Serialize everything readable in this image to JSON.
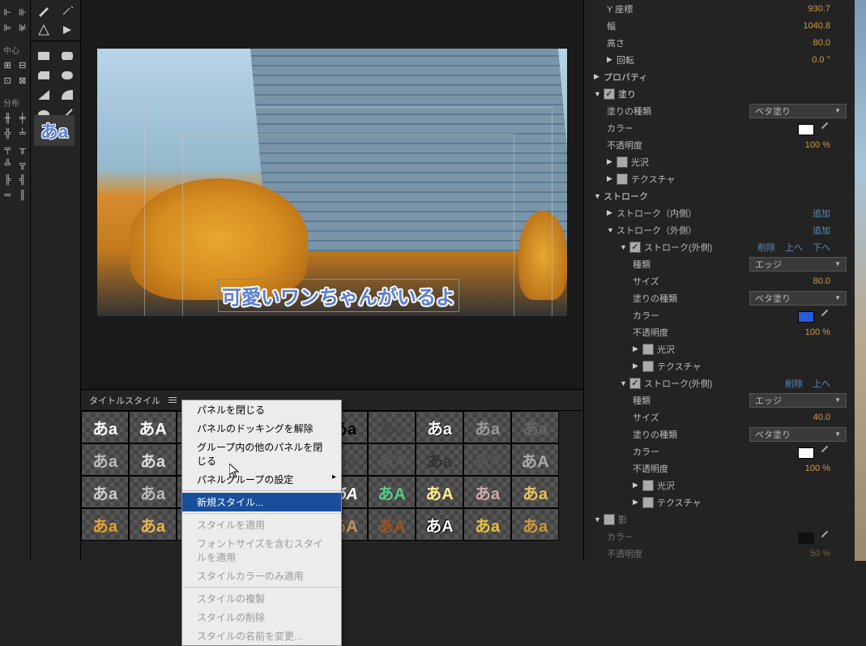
{
  "sidebar": {
    "sections": [
      "中心",
      "分布"
    ]
  },
  "preview": {
    "title_text": "可愛いワンちゃんがいるよ"
  },
  "styles_panel": {
    "tab_label": "タイトルスタイル",
    "sample_glyph_a": "あa",
    "sample_glyph_b": "あA"
  },
  "context_menu": {
    "close_panel": "パネルを閉じる",
    "undock_panel": "パネルのドッキングを解除",
    "close_others": "グループ内の他のパネルを閉じる",
    "panel_group_settings": "パネルグループの設定",
    "new_style": "新規スタイル...",
    "apply_style": "スタイルを適用",
    "apply_with_font": "フォントサイズを含むスタイルを適用",
    "apply_color_only": "スタイルカラーのみ適用",
    "duplicate_style": "スタイルの複製",
    "delete_style": "スタイルの削除",
    "rename_style": "スタイルの名前を変更..."
  },
  "props": {
    "y_value": "930.7",
    "width_label": "幅",
    "width_value": "1040.8",
    "height_label": "高さ",
    "height_value": "80.0",
    "rotation_label": "回転",
    "rotation_value": "0.0 °",
    "property_label": "プロパティ",
    "fill_label": "塗り",
    "fill_type_label": "塗りの種類",
    "fill_type_value": "ベタ塗り",
    "color_label": "カラー",
    "color_white": "#ffffff",
    "color_blue": "#2a5ad8",
    "opacity_label": "不透明度",
    "opacity_value": "100 %",
    "sheen_label": "光沢",
    "texture_label": "テクスチャ",
    "stroke_section": "ストローク",
    "stroke_inner": "ストローク（内側）",
    "stroke_outer": "ストローク（外側）",
    "stroke_outer_item": "ストローク(外側)",
    "add_link": "追加",
    "delete_link": "削除",
    "up_link": "上へ",
    "down_link": "下へ",
    "kind_label": "種類",
    "kind_value": "エッジ",
    "size_label": "サイズ",
    "size_value_1": "80.0",
    "size_value_2": "40.0",
    "shadow_label": "影",
    "shadow_opacity": "50 %"
  }
}
